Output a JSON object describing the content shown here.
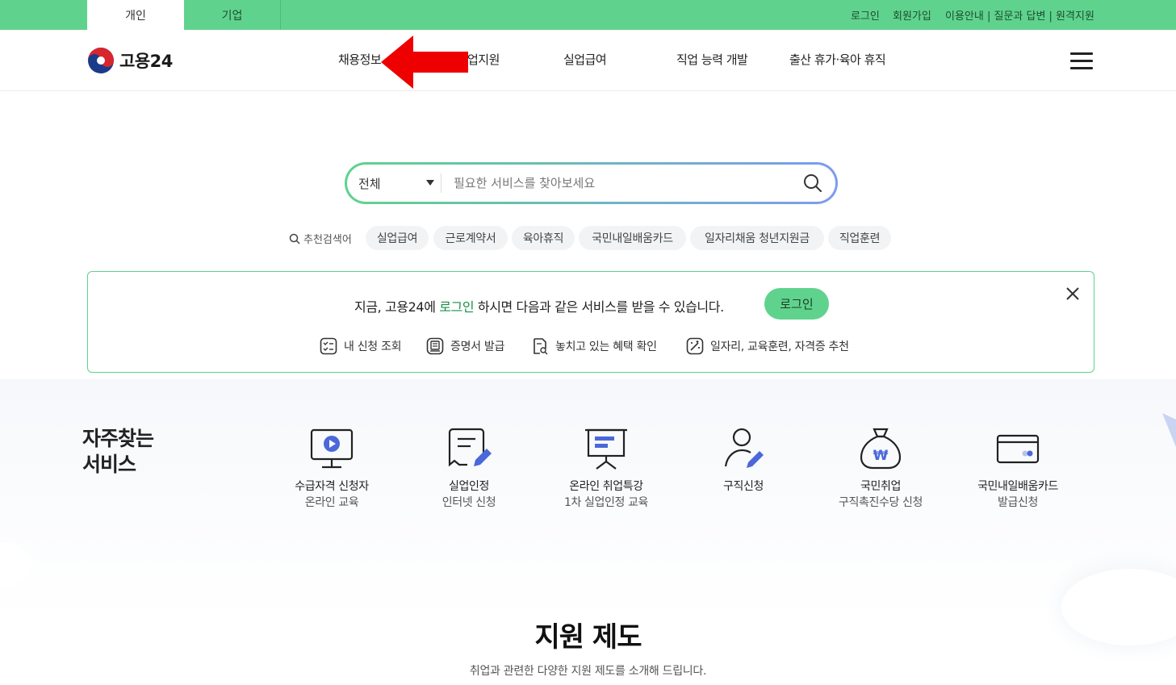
{
  "topbar": {
    "tabs": [
      {
        "label": "개인"
      },
      {
        "label": "기업"
      }
    ],
    "util_links": [
      "로그인",
      "회원가입",
      "이용안내 | 질문과 답변 | 원격지원"
    ]
  },
  "header": {
    "logo_text": "고용24",
    "nav": [
      "채용정보",
      "업지원",
      "실업급여",
      "직업 능력 개발",
      "출산 휴가·육아 휴직"
    ]
  },
  "search": {
    "category": "전체",
    "placeholder": "필요한 서비스를 찾아보세요",
    "value": ""
  },
  "keywords": {
    "label": "추천검색어",
    "items": [
      "실업급여",
      "근로계약서",
      "육아휴직",
      "국민내일배움카드",
      "일자리채움 청년지원금",
      "직업훈련"
    ]
  },
  "login_box": {
    "msg_pre": "지금, 고용24에 ",
    "msg_highlight": "로그인",
    "msg_post": " 하시면 다음과 같은 서비스를 받을 수 있습니다.",
    "button": "로그인",
    "benefits": [
      "내 신청 조회",
      "증명서 발급",
      "놓치고 있는 혜택 확인",
      "일자리, 교육훈련, 자격증 추천"
    ]
  },
  "frequent": {
    "title_line1": "자주찾는",
    "title_line2": "서비스",
    "items": [
      {
        "l1": "수급자격 신청자",
        "l2": "온라인 교육",
        "icon": "monitor-play-icon"
      },
      {
        "l1": "실업인정",
        "l2": "인터넷 신청",
        "icon": "document-pen-icon"
      },
      {
        "l1": "온라인 취업특강",
        "l2": "1차 실업인정 교육",
        "icon": "presentation-board-icon"
      },
      {
        "l1": "구직신청",
        "l2": "",
        "icon": "person-pen-icon"
      },
      {
        "l1": "국민취업",
        "l2": "구직촉진수당 신청",
        "icon": "money-bag-icon"
      },
      {
        "l1": "국민내일배움카드",
        "l2": "발급신청",
        "icon": "card-icon"
      }
    ]
  },
  "support": {
    "title": "지원 제도",
    "subtitle": "취업과 관련한 다양한 지원 제도를 소개해 드립니다."
  },
  "colors": {
    "brand_green": "#5fd38d",
    "accent_blue": "#4a68d9",
    "arrow_red": "#ee0000"
  }
}
